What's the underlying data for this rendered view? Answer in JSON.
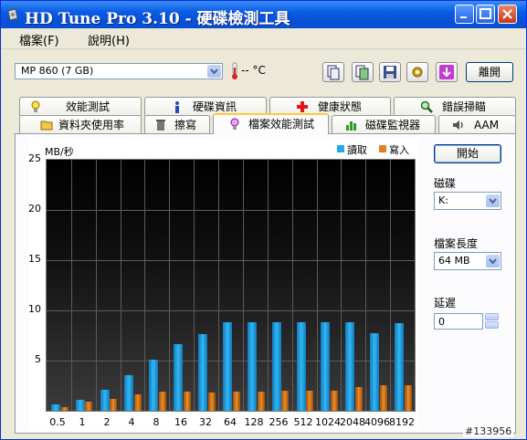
{
  "window": {
    "title": "HD Tune Pro 3.10 - 硬碟檢測工具"
  },
  "menu": {
    "items": [
      "檔案(F)",
      "說明(H)"
    ]
  },
  "toolbar": {
    "drive_label": "MP      860 (7 GB)",
    "temperature": "-- °C",
    "exit_label": "離開",
    "icons": [
      "copy-text-icon",
      "copy-screenshot-icon",
      "save-icon",
      "options-icon",
      "download-icon"
    ]
  },
  "tabs": {
    "row1": [
      "效能測試",
      "硬碟資訊",
      "健康狀態",
      "錯誤掃瞄"
    ],
    "row2": [
      "資料夾使用率",
      "擦寫",
      "檔案效能測試",
      "磁碟監視器",
      "AAM"
    ],
    "active": "檔案效能測試"
  },
  "side": {
    "start_label": "開始",
    "disk_label": "磁碟",
    "disk_value": "K:",
    "file_length_label": "檔案長度",
    "file_length_value": "64 MB",
    "delay_label": "延遲",
    "delay_value": "0"
  },
  "chart_data": {
    "type": "bar",
    "ylabel": "MB/秒",
    "ylim": [
      0,
      25
    ],
    "yticks": [
      "25",
      "20",
      "15",
      "10",
      "5"
    ],
    "categories": [
      "0.5",
      "1",
      "2",
      "4",
      "8",
      "16",
      "32",
      "64",
      "128",
      "256",
      "512",
      "1024",
      "2048",
      "4096",
      "8192"
    ],
    "series": [
      {
        "name": "讀取",
        "color": "#2aa7e6",
        "values": [
          0.6,
          1.1,
          2.1,
          3.5,
          5.1,
          6.6,
          7.6,
          8.8,
          8.8,
          8.8,
          8.8,
          8.8,
          8.8,
          7.7,
          8.7
        ]
      },
      {
        "name": "寫入",
        "color": "#e0821f",
        "values": [
          0.4,
          0.9,
          1.2,
          1.6,
          1.9,
          1.9,
          1.8,
          1.9,
          1.9,
          2.0,
          2.0,
          2.0,
          2.4,
          2.5,
          2.5
        ]
      }
    ],
    "grid": true,
    "legend": "top-right"
  },
  "watermark": "#133956"
}
